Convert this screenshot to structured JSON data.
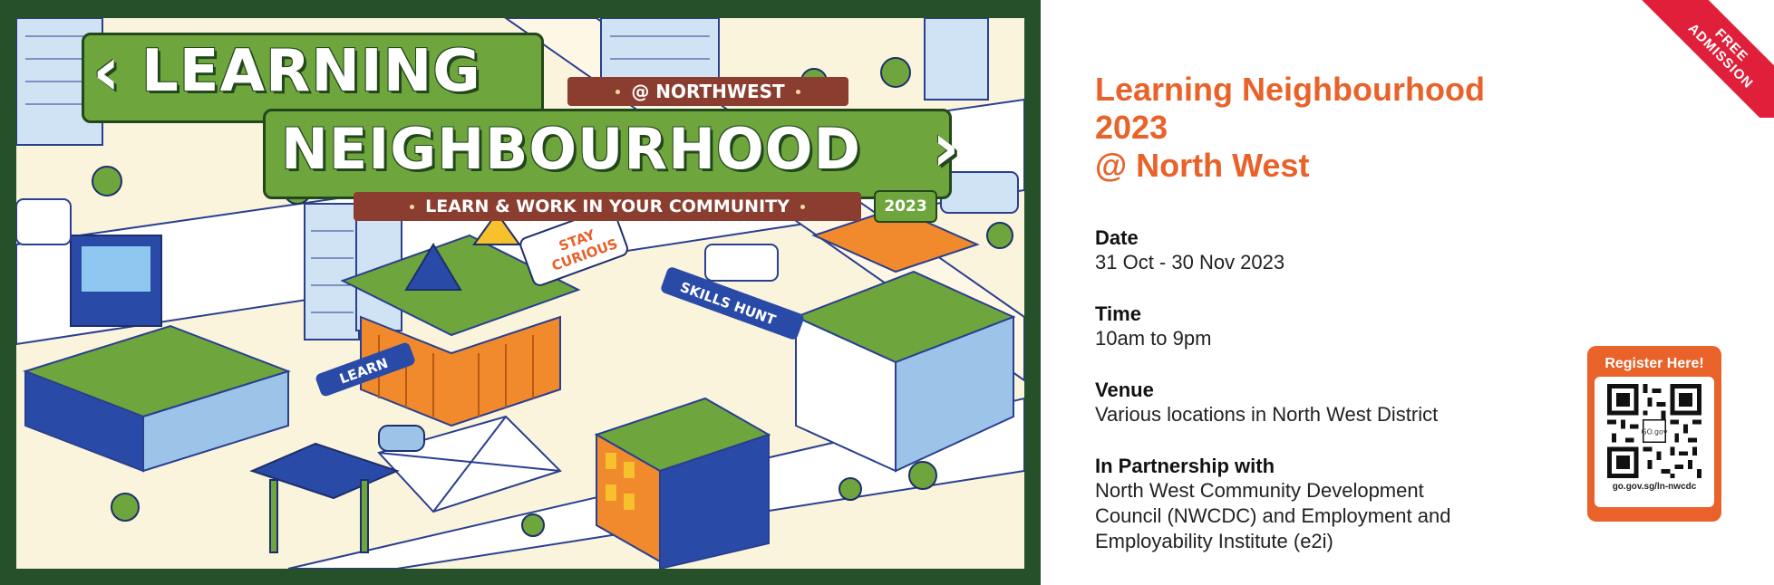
{
  "poster": {
    "title_line1": "LEARNING",
    "title_line2": "NEIGHBOURHOOD",
    "location_tag": "@ NORTHWEST",
    "tagline": "LEARN & WORK IN YOUR COMMUNITY",
    "year_badge": "2023",
    "sign_stay": "STAY",
    "sign_curious": "CURIOUS",
    "sign_skills": "SKILLS HUNT",
    "sign_learn": "LEARN"
  },
  "ribbon": {
    "line1": "FREE",
    "line2": "ADMISSION"
  },
  "event": {
    "title_line1": "Learning Neighbourhood 2023",
    "title_line2": "@ North West"
  },
  "details": [
    {
      "label": "Date",
      "value": "31 Oct - 30 Nov 2023"
    },
    {
      "label": "Time",
      "value": "10am to 9pm"
    },
    {
      "label": "Venue",
      "value": "Various locations in North West District"
    },
    {
      "label": "In Partnership with",
      "value": "North West Community Development\nCouncil (NWCDC) and Employment and\nEmployability Institute (e2i)"
    }
  ],
  "register": {
    "title": "Register Here!",
    "qr_center": "GO.gov",
    "url": "go.gov.sg/ln-nwcdc"
  },
  "colors": {
    "accent_orange": "#e8622a",
    "poster_border": "#25502a",
    "banner_green": "#6ea53c",
    "ribbon_red": "#e0203a"
  }
}
